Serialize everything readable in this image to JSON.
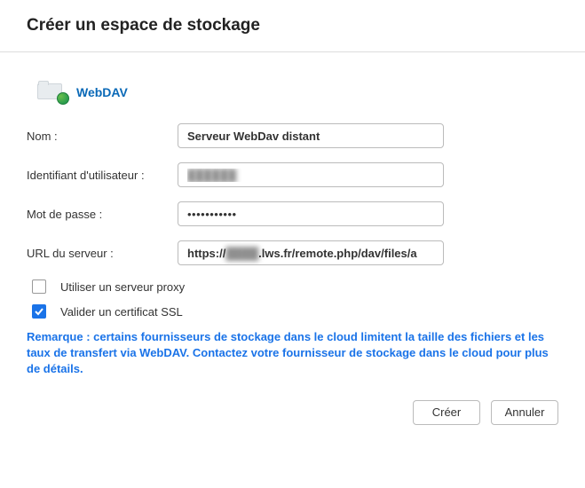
{
  "header": {
    "title": "Créer un espace de stockage"
  },
  "provider": {
    "name": "WebDAV"
  },
  "form": {
    "name_label": "Nom :",
    "name_value": "Serveur WebDav distant",
    "user_label": "Identifiant d'utilisateur :",
    "user_value": "██████",
    "password_label": "Mot de passe :",
    "password_value": "•••••••••••",
    "url_label": "URL du serveur :",
    "url_prefix": "https://",
    "url_hidden": "████",
    "url_suffix": ".lws.fr/remote.php/dav/files/a"
  },
  "options": {
    "proxy_label": "Utiliser un serveur proxy",
    "proxy_checked": false,
    "ssl_label": "Valider un certificat SSL",
    "ssl_checked": true
  },
  "note": "Remarque : certains fournisseurs de stockage dans le cloud limitent la taille des fichiers et les taux de transfert via WebDAV. Contactez votre fournisseur de stockage dans le cloud pour plus de détails.",
  "buttons": {
    "create": "Créer",
    "cancel": "Annuler"
  }
}
